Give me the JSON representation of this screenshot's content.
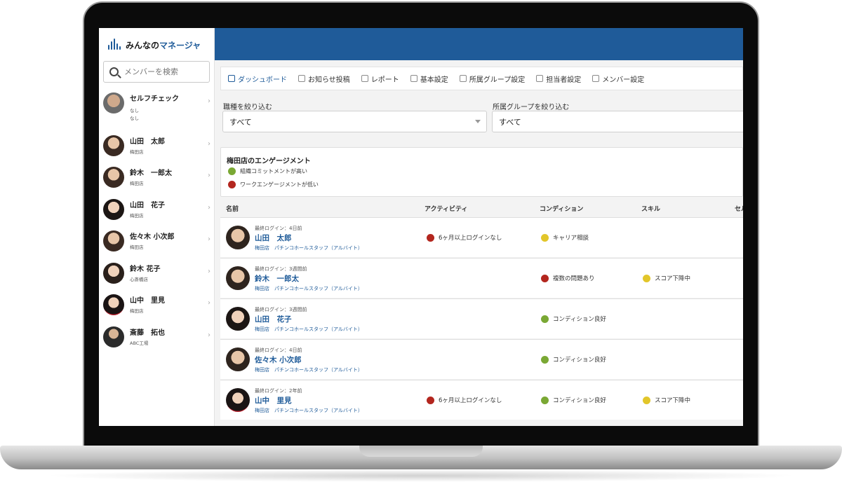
{
  "app": {
    "logo_main": "みんなの",
    "logo_accent": "マネージャ"
  },
  "sidebar": {
    "search_placeholder": "メンバーを検索",
    "members": [
      {
        "name": "セルフチェック",
        "sub1": "なし",
        "sub2": "なし"
      },
      {
        "name": "山田　太郎",
        "sub1": "梅田店"
      },
      {
        "name": "鈴木　一郎太",
        "sub1": "梅田店"
      },
      {
        "name": "山田　花子",
        "sub1": "梅田店"
      },
      {
        "name": "佐々木 小次郎",
        "sub1": "梅田店"
      },
      {
        "name": "鈴木 花子",
        "sub1": "心斎橋店"
      },
      {
        "name": "山中　里見",
        "sub1": "梅田店"
      },
      {
        "name": "斎藤　拓也",
        "sub1": "ABC工場"
      }
    ]
  },
  "nav": {
    "items": [
      {
        "label": "ダッシュボード",
        "icon": "chart-icon"
      },
      {
        "label": "お知らせ投稿",
        "icon": "bell-icon"
      },
      {
        "label": "レポート",
        "icon": "report-icon"
      },
      {
        "label": "基本設定",
        "icon": "gear-icon"
      },
      {
        "label": "所属グループ設定",
        "icon": "gear-icon"
      },
      {
        "label": "担当者設定",
        "icon": "gear-icon"
      },
      {
        "label": "メンバー設定",
        "icon": "gear-icon"
      }
    ]
  },
  "filters": {
    "job_label": "職種を絞り込む",
    "job_value": "すべて",
    "group_label": "所属グループを絞り込む",
    "group_value": "すべて"
  },
  "engagement": {
    "title": "梅田店のエンゲージメント",
    "legend": [
      {
        "label": "組織コミットメントが高い",
        "color": "#7aa834"
      },
      {
        "label": "ワークエンゲージメントが低い",
        "color": "#b3261e"
      }
    ]
  },
  "table": {
    "headers": {
      "name": "名前",
      "activity": "アクティビティ",
      "condition": "コンディション",
      "skill": "スキル",
      "extra": "セル"
    },
    "rows": [
      {
        "login": "最終ログイン：4日前",
        "name": "山田　太郎",
        "sub": "梅田店　パチンコホールスタッフ（アルバイト）",
        "activity": "6ヶ月以上ログインなし",
        "condition": "キャリア相談",
        "skill": ""
      },
      {
        "login": "最終ログイン：3週間前",
        "name": "鈴木　一郎太",
        "sub": "梅田店　パチンコホールスタッフ（アルバイト）",
        "activity": "",
        "condition": "複数の問題あり",
        "skill": "スコア下降中"
      },
      {
        "login": "最終ログイン：3週間前",
        "name": "山田　花子",
        "sub": "梅田店　パチンコホールスタッフ（アルバイト）",
        "activity": "",
        "condition": "コンディション良好",
        "skill": ""
      },
      {
        "login": "最終ログイン：4日前",
        "name": "佐々木 小次郎",
        "sub": "梅田店　パチンコホールスタッフ（アルバイト）",
        "activity": "",
        "condition": "コンディション良好",
        "skill": ""
      },
      {
        "login": "最終ログイン：2年前",
        "name": "山中　里見",
        "sub": "梅田店　パチンコホールスタッフ（アルバイト）",
        "activity": "6ヶ月以上ログインなし",
        "condition": "コンディション良好",
        "skill": "スコア下降中"
      }
    ]
  },
  "colors": {
    "brand": "#1f5b99",
    "red": "#b3261e",
    "green": "#7aa834",
    "yellow": "#e2c62a"
  }
}
